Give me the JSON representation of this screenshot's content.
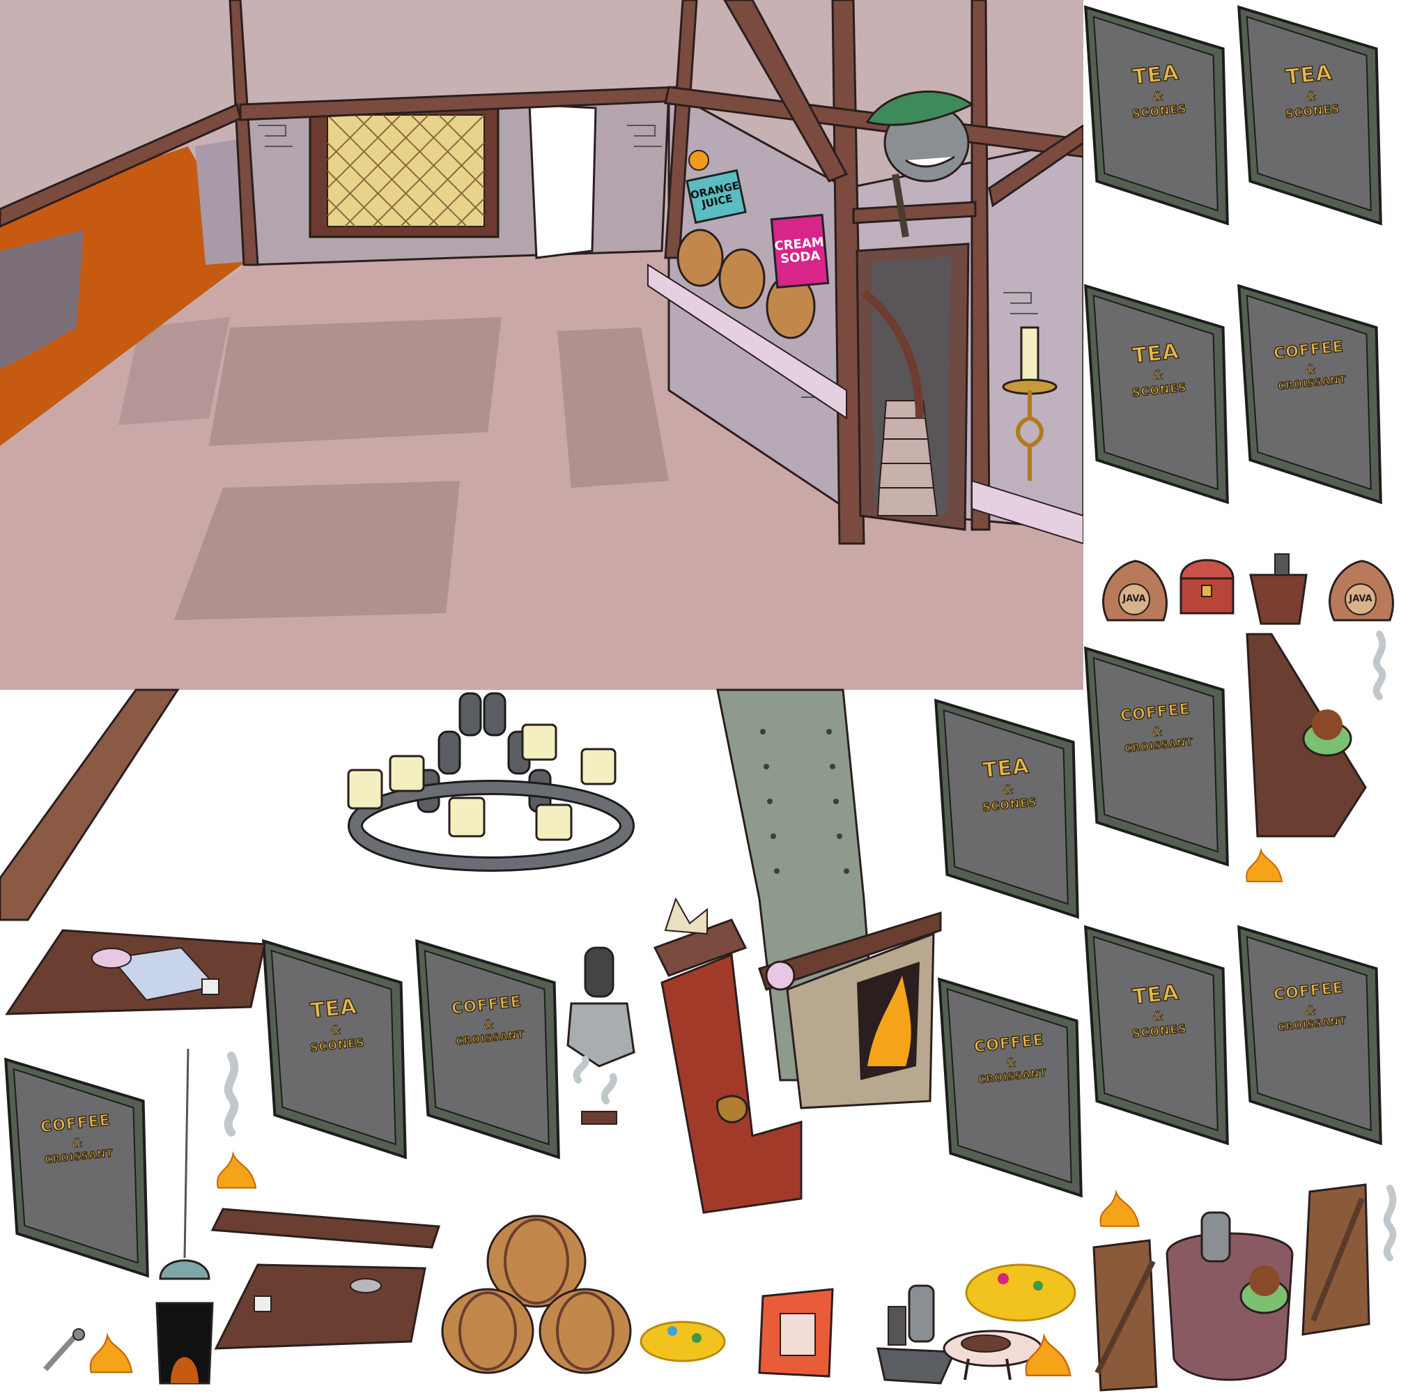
{
  "room": {
    "signs": {
      "orange_juice": [
        "ORANGE",
        "JUICE"
      ],
      "cream_soda": [
        "CREAM",
        "SODA"
      ]
    },
    "colors": {
      "wall": "#c9b4b8",
      "floor": "#c9a9a8",
      "beam": "#7a4b3e",
      "orange_wall": "#c65a10",
      "brick_wall": "#a89aa8"
    }
  },
  "menu_boards": [
    {
      "id": "b1",
      "line1": "TEA",
      "amp": "&",
      "line2": "SCONES"
    },
    {
      "id": "b2",
      "line1": "TEA",
      "amp": "&",
      "line2": "SCONES"
    },
    {
      "id": "b3",
      "line1": "TEA",
      "amp": "&",
      "line2": "SCONES"
    },
    {
      "id": "b4",
      "line1": "COFFEE",
      "amp": "&",
      "line2": "CROISSANT"
    },
    {
      "id": "b5",
      "line1": "COFFEE",
      "amp": "&",
      "line2": "CROISSANT"
    },
    {
      "id": "b6",
      "line1": "TEA",
      "amp": "&",
      "line2": "SCONES"
    },
    {
      "id": "b7",
      "line1": "TEA",
      "amp": "&",
      "line2": "SCONES"
    },
    {
      "id": "b8",
      "line1": "COFFEE",
      "amp": "&",
      "line2": "CROISSANT"
    },
    {
      "id": "b9",
      "line1": "COFFEE",
      "amp": "&",
      "line2": "CROISSANT"
    },
    {
      "id": "b10",
      "line1": "TEA",
      "amp": "&",
      "line2": "SCONES"
    },
    {
      "id": "b11",
      "line1": "COFFEE",
      "amp": "&",
      "line2": "CROISSANT"
    },
    {
      "id": "b12",
      "line1": "COFFEE",
      "amp": "&",
      "line2": "CROISSANT"
    }
  ],
  "sacks": [
    {
      "id": "s1",
      "label": "JAVA"
    },
    {
      "id": "s2",
      "label": "JAVA"
    }
  ],
  "icons": {
    "shark": "shark-trophy-icon",
    "candle": "candle-sconce-icon",
    "chandelier": "chandelier-icon",
    "barrel": "barrel-icon",
    "fire": "fire-icon",
    "steam": "steam-icon",
    "gold": "gold-pile-icon",
    "door": "door-icon",
    "chest": "treasure-chest-icon",
    "grinder": "coffee-grinder-icon"
  }
}
